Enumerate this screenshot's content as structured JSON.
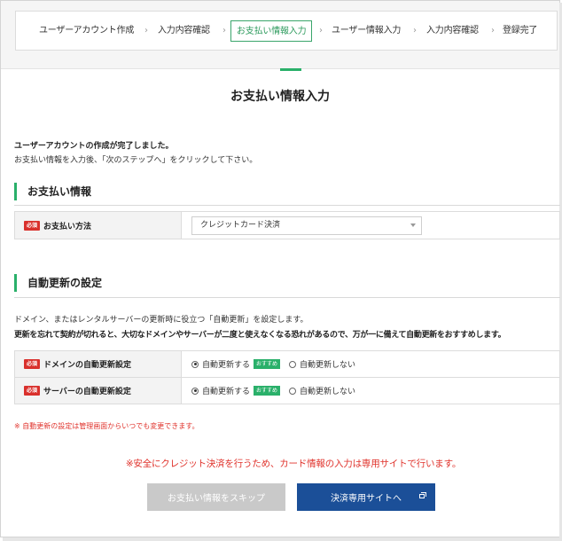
{
  "steps": [
    {
      "label": "ユーザーアカウント作成"
    },
    {
      "label": "入力内容確認"
    },
    {
      "label": "お支払い情報入力"
    },
    {
      "label": "ユーザー情報入力"
    },
    {
      "label": "入力内容確認"
    },
    {
      "label": "登録完了"
    }
  ],
  "steps_active_index": 2,
  "page_title": "お支払い情報入力",
  "intro": {
    "line1": "ユーザーアカウントの作成が完了しました。",
    "line2": "お支払い情報を入力後、「次のステップへ」をクリックして下さい。"
  },
  "payment": {
    "heading": "お支払い情報",
    "badge": "必須",
    "label": "お支払い方法",
    "selected": "クレジットカード決済"
  },
  "auto_renew": {
    "heading": "自動更新の設定",
    "desc1": "ドメイン、またはレンタルサーバーの更新時に役立つ「自動更新」を設定します。",
    "desc2": "更新を忘れて契約が切れると、大切なドメインやサーバーが二度と使えなくなる恐れがあるので、万が一に備えて自動更新をおすすめします。",
    "rows": [
      {
        "badge": "必須",
        "label": "ドメインの自動更新設定",
        "option_on": "自動更新する",
        "recommend": "おすすめ",
        "option_off": "自動更新しない"
      },
      {
        "badge": "必須",
        "label": "サーバーの自動更新設定",
        "option_on": "自動更新する",
        "recommend": "おすすめ",
        "option_off": "自動更新しない"
      }
    ],
    "note": "※ 自動更新の設定は管理画面からいつでも変更できます。"
  },
  "warning": "※安全にクレジット決済を行うため、カード情報の入力は専用サイトで行います。",
  "buttons": {
    "skip": "お支払い情報をスキップ",
    "pay": "決済専用サイトへ"
  },
  "colors": {
    "accent_green": "#2ab06a",
    "required_red": "#d9302c",
    "warning_red": "#e0332c",
    "primary_blue": "#1b4f98",
    "disabled_gray": "#c9c9c9"
  }
}
